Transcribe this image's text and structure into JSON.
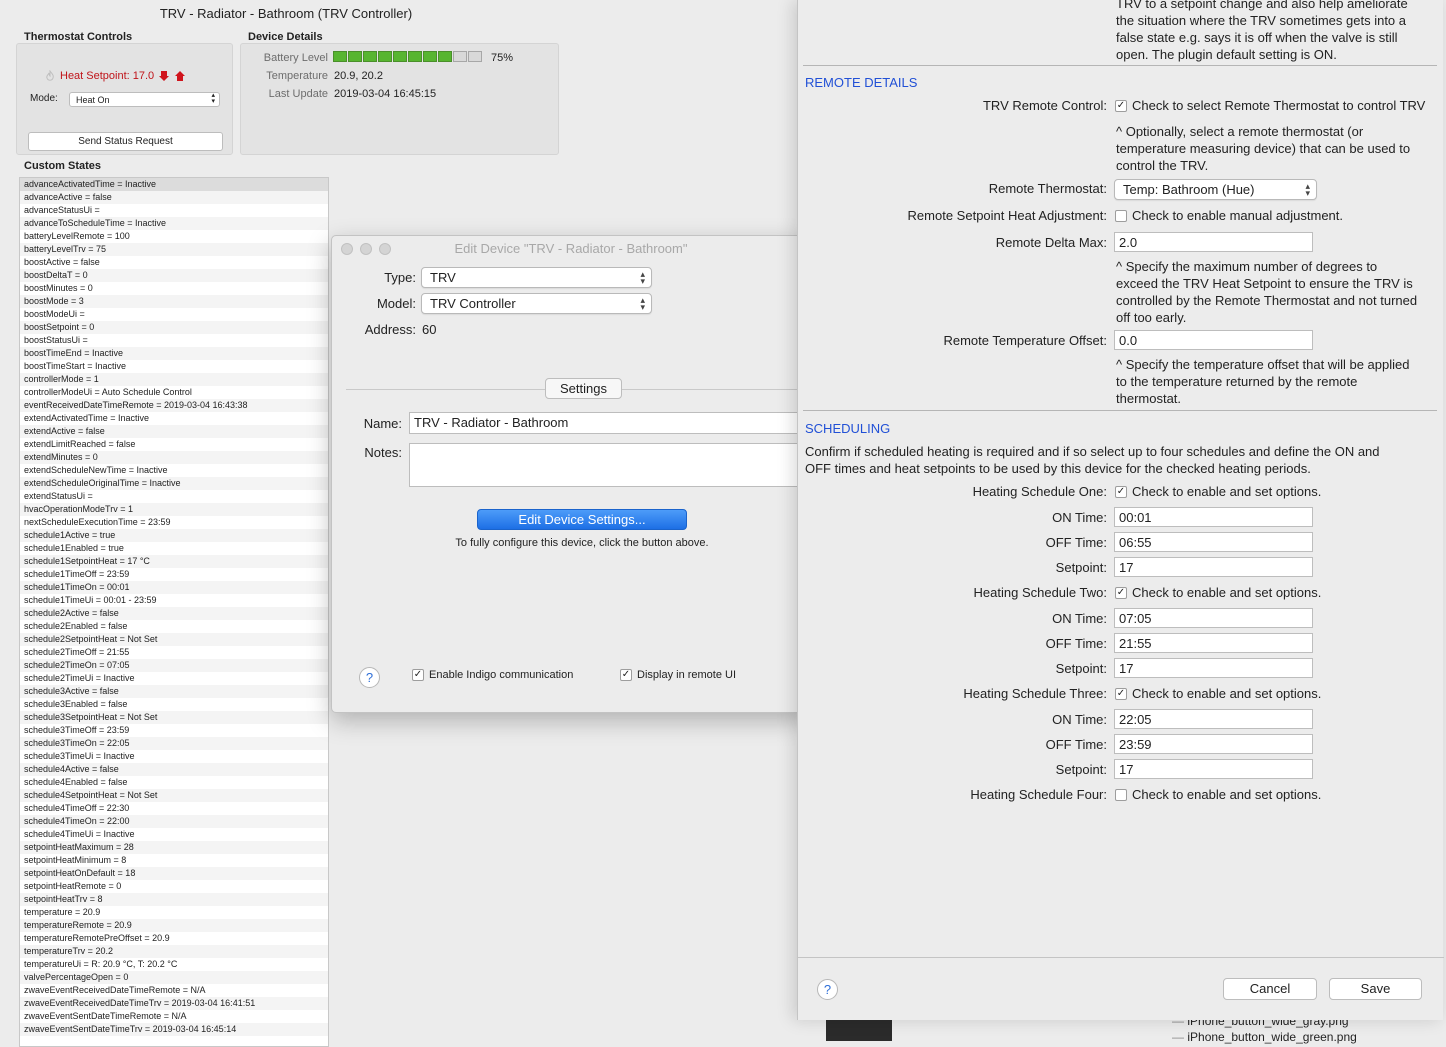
{
  "main": {
    "title": "TRV - Radiator - Bathroom (TRV Controller)",
    "thermostat_controls": {
      "heading": "Thermostat Controls",
      "heat_setpoint": "Heat Setpoint: 17.0",
      "mode_label": "Mode:",
      "mode_value": "Heat On",
      "status_button": "Send Status Request"
    },
    "device_details": {
      "heading": "Device Details",
      "battery_label": "Battery Level",
      "battery_percent": "75%",
      "battery_fraction": 0.75,
      "temperature_label": "Temperature",
      "temperature_value": "20.9, 20.2",
      "last_update_label": "Last Update",
      "last_update_value": "2019-03-04 16:45:15"
    },
    "custom_states_heading": "Custom States",
    "custom_states": [
      "advanceActivatedTime = Inactive",
      "advanceActive = false",
      "advanceStatusUi =",
      "advanceToScheduleTime = Inactive",
      "batteryLevelRemote = 100",
      "batteryLevelTrv = 75",
      "boostActive = false",
      "boostDeltaT = 0",
      "boostMinutes = 0",
      "boostMode = 3",
      "boostModeUi =",
      "boostSetpoint = 0",
      "boostStatusUi =",
      "boostTimeEnd = Inactive",
      "boostTimeStart = Inactive",
      "controllerMode = 1",
      "controllerModeUi = Auto Schedule Control",
      "eventReceivedDateTimeRemote = 2019-03-04 16:43:38",
      "extendActivatedTime = Inactive",
      "extendActive = false",
      "extendLimitReached = false",
      "extendMinutes = 0",
      "extendScheduleNewTime = Inactive",
      "extendScheduleOriginalTime = Inactive",
      "extendStatusUi =",
      "hvacOperationModeTrv = 1",
      "nextScheduleExecutionTime = 23:59",
      "schedule1Active = true",
      "schedule1Enabled = true",
      "schedule1SetpointHeat = 17 °C",
      "schedule1TimeOff = 23:59",
      "schedule1TimeOn = 00:01",
      "schedule1TimeUi = 00:01 - 23:59",
      "schedule2Active = false",
      "schedule2Enabled = false",
      "schedule2SetpointHeat = Not Set",
      "schedule2TimeOff = 21:55",
      "schedule2TimeOn = 07:05",
      "schedule2TimeUi = Inactive",
      "schedule3Active = false",
      "schedule3Enabled = false",
      "schedule3SetpointHeat = Not Set",
      "schedule3TimeOff = 23:59",
      "schedule3TimeOn = 22:05",
      "schedule3TimeUi = Inactive",
      "schedule4Active = false",
      "schedule4Enabled = false",
      "schedule4SetpointHeat = Not Set",
      "schedule4TimeOff = 22:30",
      "schedule4TimeOn = 22:00",
      "schedule4TimeUi = Inactive",
      "setpointHeatMaximum = 28",
      "setpointHeatMinimum = 8",
      "setpointHeatOnDefault = 18",
      "setpointHeatRemote = 0",
      "setpointHeatTrv = 8",
      "temperature = 20.9",
      "temperatureRemote = 20.9",
      "temperatureRemotePreOffset = 20.9",
      "temperatureTrv = 20.2",
      "temperatureUi = R: 20.9 °C, T: 20.2 °C",
      "valvePercentageOpen = 0",
      "zwaveEventReceivedDateTimeRemote = N/A",
      "zwaveEventReceivedDateTimeTrv = 2019-03-04 16:41:51",
      "zwaveEventSentDateTimeRemote = N/A",
      "zwaveEventSentDateTimeTrv = 2019-03-04 16:45:14"
    ]
  },
  "edit_dialog": {
    "title": "Edit Device \"TRV - Radiator - Bathroom\"",
    "type_label": "Type:",
    "type_value": "TRV",
    "model_label": "Model:",
    "model_value": "TRV Controller",
    "address_label": "Address:",
    "address_value": "60",
    "settings_tab": "Settings",
    "name_label": "Name:",
    "name_value": "TRV - Radiator - Bathroom",
    "notes_label": "Notes:",
    "notes_value": "",
    "edit_settings_button": "Edit Device Settings...",
    "hint": "To fully configure this device, click the button above.",
    "help": "?",
    "enable_comm_label": "Enable Indigo communication",
    "enable_comm_checked": true,
    "remote_ui_label": "Display in remote UI",
    "remote_ui_checked": true
  },
  "sheet": {
    "top_text_lines": [
      "TRV to a setpoint change and also help ameliorate",
      "the situation where the TRV sometimes gets into a",
      "false state e.g. says it is off when the valve is still",
      "open. The plugin default setting is ON."
    ],
    "remote_details_heading": "REMOTE DETAILS",
    "trv_remote_control_label": "TRV Remote Control:",
    "trv_remote_control_text": "Check to select Remote Thermostat to control TRV",
    "trv_remote_control_checked": true,
    "remote_control_note": [
      "^ Optionally, select a remote thermostat (or",
      "temperature measuring device) that can be used to",
      "control the TRV."
    ],
    "remote_thermostat_label": "Remote Thermostat:",
    "remote_thermostat_value": "Temp: Bathroom (Hue)",
    "setpoint_adjust_label": "Remote Setpoint Heat Adjustment:",
    "setpoint_adjust_text": "Check to enable manual adjustment.",
    "setpoint_adjust_checked": false,
    "delta_max_label": "Remote Delta Max:",
    "delta_max_value": "2.0",
    "delta_max_note": [
      "^ Specify the maximum number of degrees to",
      "exceed the TRV Heat Setpoint to ensure the TRV is",
      "controlled by the Remote Thermostat and not turned",
      "off too early."
    ],
    "temp_offset_label": "Remote Temperature Offset:",
    "temp_offset_value": "0.0",
    "temp_offset_note": [
      "^ Specify the temperature offset that will be applied",
      "to the temperature returned by the remote",
      "thermostat."
    ],
    "scheduling_heading": "SCHEDULING",
    "scheduling_intro": [
      "Confirm if scheduled heating is required and if so select up to four schedules and define the ON and",
      "OFF times and heat setpoints to be used by this device for the checked heating periods."
    ],
    "schedule_check_text": "Check to enable and set options.",
    "on_time_label": "ON Time:",
    "off_time_label": "OFF Time:",
    "setpoint_label": "Setpoint:",
    "schedules": [
      {
        "label": "Heating Schedule One:",
        "checked": true,
        "on": "00:01",
        "off": "06:55",
        "setpoint": "17"
      },
      {
        "label": "Heating Schedule Two:",
        "checked": true,
        "on": "07:05",
        "off": "21:55",
        "setpoint": "17"
      },
      {
        "label": "Heating Schedule Three:",
        "checked": true,
        "on": "22:05",
        "off": "23:59",
        "setpoint": "17"
      },
      {
        "label": "Heating Schedule Four:",
        "checked": false
      }
    ],
    "help": "?",
    "cancel_button": "Cancel",
    "save_button": "Save"
  },
  "background_files": [
    "iPhone_button_wide_gray.png",
    "iPhone_button_wide_green.png"
  ],
  "colors": {
    "accent_blue": "#1d6fe5",
    "section_blue": "#2150d6",
    "setpoint_red": "#c0141a",
    "battery_green": "#57b530"
  }
}
